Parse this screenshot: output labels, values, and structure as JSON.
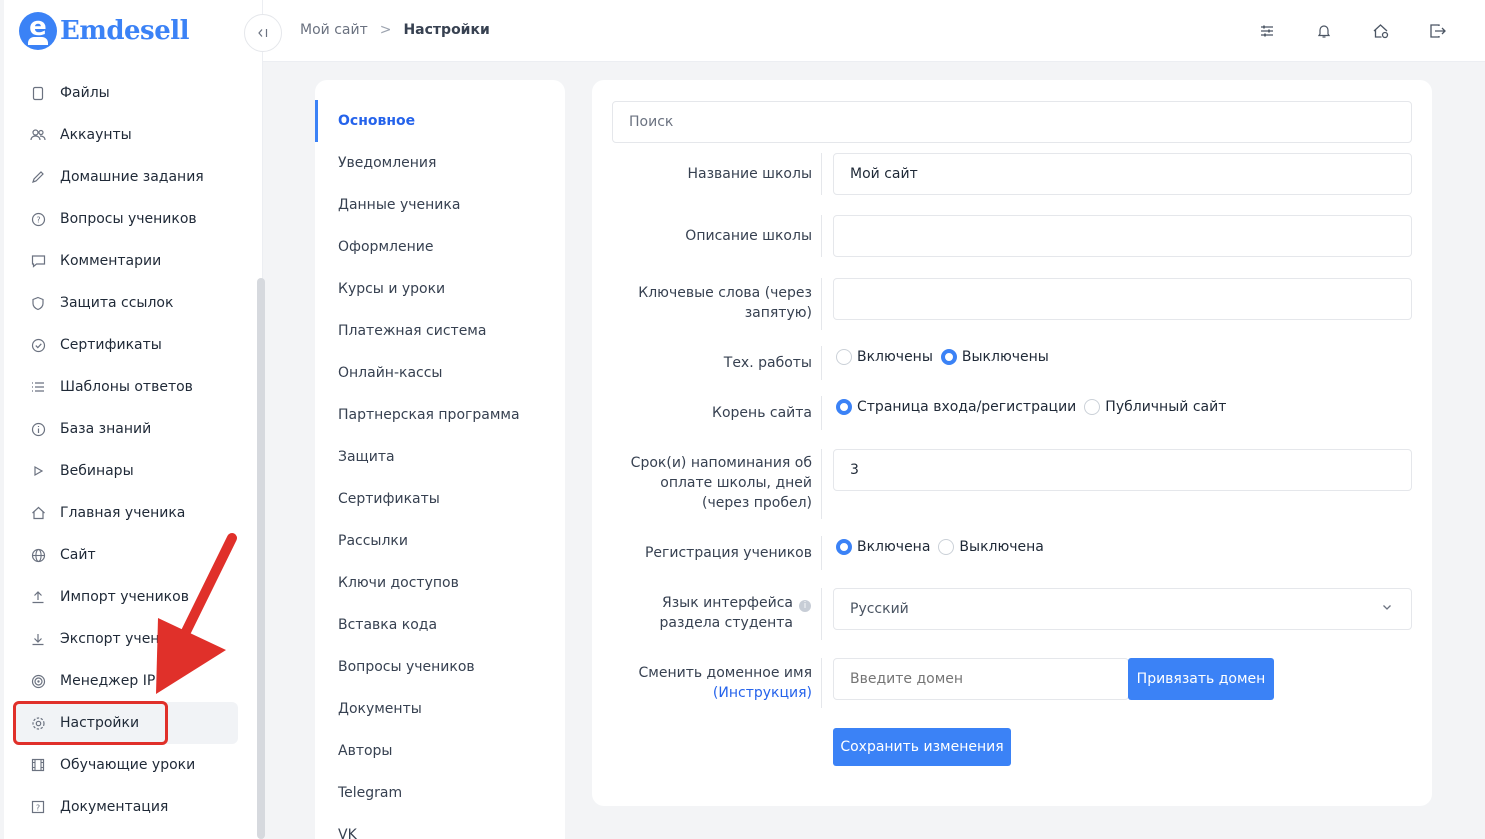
{
  "brand": {
    "logo_letter": "e",
    "name": "Emdesell"
  },
  "sidebar": {
    "items": [
      {
        "label": "Файлы",
        "icon": "file-icon"
      },
      {
        "label": "Аккаунты",
        "icon": "users-icon"
      },
      {
        "label": "Домашние задания",
        "icon": "pencil-icon"
      },
      {
        "label": "Вопросы учеников",
        "icon": "question-icon"
      },
      {
        "label": "Комментарии",
        "icon": "comment-icon"
      },
      {
        "label": "Защита ссылок",
        "icon": "shield-icon"
      },
      {
        "label": "Сертификаты",
        "icon": "check-circle-icon"
      },
      {
        "label": "Шаблоны ответов",
        "icon": "list-icon"
      },
      {
        "label": "База знаний",
        "icon": "info-icon"
      },
      {
        "label": "Вебинары",
        "icon": "play-icon"
      },
      {
        "label": "Главная ученика",
        "icon": "home-icon"
      },
      {
        "label": "Сайт",
        "icon": "globe-icon"
      },
      {
        "label": "Импорт учеников",
        "icon": "upload-icon"
      },
      {
        "label": "Экспорт учен",
        "icon": "download-icon"
      },
      {
        "label": "Менеджер IP",
        "icon": "target-icon"
      },
      {
        "label": "Настройки",
        "icon": "gear-icon",
        "active": true
      },
      {
        "label": "Обучающие уроки",
        "icon": "film-icon"
      },
      {
        "label": "Документация",
        "icon": "help-box-icon"
      }
    ]
  },
  "header": {
    "breadcrumb": {
      "root": "Мой сайт",
      "separator": ">",
      "current": "Настройки"
    },
    "icons": [
      "sliders-icon",
      "bell-icon",
      "home-settings-icon",
      "logout-icon"
    ]
  },
  "settings_nav": {
    "items": [
      "Основное",
      "Уведомления",
      "Данные ученика",
      "Оформление",
      "Курсы и уроки",
      "Платежная система",
      "Онлайн-кассы",
      "Партнерская программа",
      "Защита",
      "Сертификаты",
      "Рассылки",
      "Ключи доступов",
      "Вставка кода",
      "Вопросы учеников",
      "Документы",
      "Авторы",
      "Telegram",
      "VK"
    ],
    "active": "Основное"
  },
  "form": {
    "search_placeholder": "Поиск",
    "school_name": {
      "label": "Название школы",
      "value": "Мой сайт"
    },
    "school_description": {
      "label": "Описание школы",
      "value": ""
    },
    "keywords": {
      "label": "Ключевые слова (через запятую)",
      "value": ""
    },
    "maintenance": {
      "label": "Тех. работы",
      "option_on": "Включены",
      "option_off": "Выключены",
      "selected": "off"
    },
    "site_root": {
      "label": "Корень сайта",
      "option_login": "Страница входа/регистрации",
      "option_public": "Публичный сайт",
      "selected": "login"
    },
    "reminder_days": {
      "label": "Срок(и) напоминания об оплате школы, дней (через пробел)",
      "value": "3"
    },
    "registration": {
      "label": "Регистрация учеников",
      "option_on": "Включена",
      "option_off": "Выключена",
      "selected": "on"
    },
    "language": {
      "label": "Язык интерфейса раздела студента",
      "info": "i",
      "value": "Русский"
    },
    "domain": {
      "label": "Сменить доменное имя",
      "link": "(Инструкция)",
      "placeholder": "Введите домен",
      "bind_button": "Привязать домен"
    },
    "save_button": "Сохранить изменения"
  },
  "colors": {
    "accent": "#3b82f6",
    "annotation": "#e0302a"
  }
}
